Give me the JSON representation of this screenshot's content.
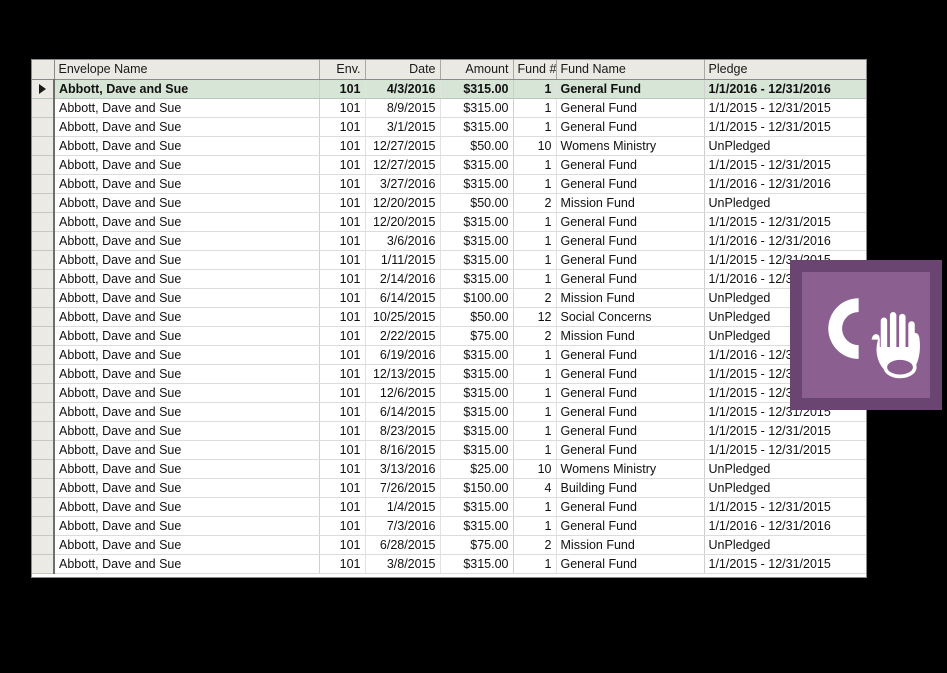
{
  "grid": {
    "columns": [
      {
        "key": "selector",
        "label": "",
        "align": "center"
      },
      {
        "key": "envelope_name",
        "label": "Envelope Name",
        "align": "left"
      },
      {
        "key": "env",
        "label": "Env.",
        "align": "right"
      },
      {
        "key": "date",
        "label": "Date",
        "align": "right"
      },
      {
        "key": "amount",
        "label": "Amount",
        "align": "right"
      },
      {
        "key": "fund_num",
        "label": "Fund #",
        "align": "right"
      },
      {
        "key": "fund_name",
        "label": "Fund Name",
        "align": "left"
      },
      {
        "key": "pledge",
        "label": "Pledge",
        "align": "left"
      }
    ],
    "selected_row_index": 0,
    "row_marker_glyph": "right-triangle",
    "rows": [
      {
        "envelope_name": "Abbott, Dave and Sue",
        "env": "101",
        "date": "4/3/2016",
        "amount": "$315.00",
        "fund_num": "1",
        "fund_name": "General Fund",
        "pledge": "1/1/2016 - 12/31/2016"
      },
      {
        "envelope_name": "Abbott, Dave and Sue",
        "env": "101",
        "date": "8/9/2015",
        "amount": "$315.00",
        "fund_num": "1",
        "fund_name": "General Fund",
        "pledge": "1/1/2015 - 12/31/2015"
      },
      {
        "envelope_name": "Abbott, Dave and Sue",
        "env": "101",
        "date": "3/1/2015",
        "amount": "$315.00",
        "fund_num": "1",
        "fund_name": "General Fund",
        "pledge": "1/1/2015 - 12/31/2015"
      },
      {
        "envelope_name": "Abbott, Dave and Sue",
        "env": "101",
        "date": "12/27/2015",
        "amount": "$50.00",
        "fund_num": "10",
        "fund_name": "Womens Ministry",
        "pledge": "UnPledged"
      },
      {
        "envelope_name": "Abbott, Dave and Sue",
        "env": "101",
        "date": "12/27/2015",
        "amount": "$315.00",
        "fund_num": "1",
        "fund_name": "General Fund",
        "pledge": "1/1/2015 - 12/31/2015"
      },
      {
        "envelope_name": "Abbott, Dave and Sue",
        "env": "101",
        "date": "3/27/2016",
        "amount": "$315.00",
        "fund_num": "1",
        "fund_name": "General Fund",
        "pledge": "1/1/2016 - 12/31/2016"
      },
      {
        "envelope_name": "Abbott, Dave and Sue",
        "env": "101",
        "date": "12/20/2015",
        "amount": "$50.00",
        "fund_num": "2",
        "fund_name": "Mission Fund",
        "pledge": "UnPledged"
      },
      {
        "envelope_name": "Abbott, Dave and Sue",
        "env": "101",
        "date": "12/20/2015",
        "amount": "$315.00",
        "fund_num": "1",
        "fund_name": "General Fund",
        "pledge": "1/1/2015 - 12/31/2015"
      },
      {
        "envelope_name": "Abbott, Dave and Sue",
        "env": "101",
        "date": "3/6/2016",
        "amount": "$315.00",
        "fund_num": "1",
        "fund_name": "General Fund",
        "pledge": "1/1/2016 - 12/31/2016"
      },
      {
        "envelope_name": "Abbott, Dave and Sue",
        "env": "101",
        "date": "1/11/2015",
        "amount": "$315.00",
        "fund_num": "1",
        "fund_name": "General Fund",
        "pledge": "1/1/2015 - 12/31/2015"
      },
      {
        "envelope_name": "Abbott, Dave and Sue",
        "env": "101",
        "date": "2/14/2016",
        "amount": "$315.00",
        "fund_num": "1",
        "fund_name": "General Fund",
        "pledge": "1/1/2016 - 12/31/2016"
      },
      {
        "envelope_name": "Abbott, Dave and Sue",
        "env": "101",
        "date": "6/14/2015",
        "amount": "$100.00",
        "fund_num": "2",
        "fund_name": "Mission Fund",
        "pledge": "UnPledged"
      },
      {
        "envelope_name": "Abbott, Dave and Sue",
        "env": "101",
        "date": "10/25/2015",
        "amount": "$50.00",
        "fund_num": "12",
        "fund_name": "Social Concerns",
        "pledge": "UnPledged"
      },
      {
        "envelope_name": "Abbott, Dave and Sue",
        "env": "101",
        "date": "2/22/2015",
        "amount": "$75.00",
        "fund_num": "2",
        "fund_name": "Mission Fund",
        "pledge": "UnPledged"
      },
      {
        "envelope_name": "Abbott, Dave and Sue",
        "env": "101",
        "date": "6/19/2016",
        "amount": "$315.00",
        "fund_num": "1",
        "fund_name": "General Fund",
        "pledge": "1/1/2016 - 12/31/2016"
      },
      {
        "envelope_name": "Abbott, Dave and Sue",
        "env": "101",
        "date": "12/13/2015",
        "amount": "$315.00",
        "fund_num": "1",
        "fund_name": "General Fund",
        "pledge": "1/1/2015 - 12/31/2015"
      },
      {
        "envelope_name": "Abbott, Dave and Sue",
        "env": "101",
        "date": "12/6/2015",
        "amount": "$315.00",
        "fund_num": "1",
        "fund_name": "General Fund",
        "pledge": "1/1/2015 - 12/31/2015"
      },
      {
        "envelope_name": "Abbott, Dave and Sue",
        "env": "101",
        "date": "6/14/2015",
        "amount": "$315.00",
        "fund_num": "1",
        "fund_name": "General Fund",
        "pledge": "1/1/2015 - 12/31/2015"
      },
      {
        "envelope_name": "Abbott, Dave and Sue",
        "env": "101",
        "date": "8/23/2015",
        "amount": "$315.00",
        "fund_num": "1",
        "fund_name": "General Fund",
        "pledge": "1/1/2015 - 12/31/2015"
      },
      {
        "envelope_name": "Abbott, Dave and Sue",
        "env": "101",
        "date": "8/16/2015",
        "amount": "$315.00",
        "fund_num": "1",
        "fund_name": "General Fund",
        "pledge": "1/1/2015 - 12/31/2015"
      },
      {
        "envelope_name": "Abbott, Dave and Sue",
        "env": "101",
        "date": "3/13/2016",
        "amount": "$25.00",
        "fund_num": "10",
        "fund_name": "Womens Ministry",
        "pledge": "UnPledged"
      },
      {
        "envelope_name": "Abbott, Dave and Sue",
        "env": "101",
        "date": "7/26/2015",
        "amount": "$150.00",
        "fund_num": "4",
        "fund_name": "Building Fund",
        "pledge": "UnPledged"
      },
      {
        "envelope_name": "Abbott, Dave and Sue",
        "env": "101",
        "date": "1/4/2015",
        "amount": "$315.00",
        "fund_num": "1",
        "fund_name": "General Fund",
        "pledge": "1/1/2015 - 12/31/2015"
      },
      {
        "envelope_name": "Abbott, Dave and Sue",
        "env": "101",
        "date": "7/3/2016",
        "amount": "$315.00",
        "fund_num": "1",
        "fund_name": "General Fund",
        "pledge": "1/1/2016 - 12/31/2016"
      },
      {
        "envelope_name": "Abbott, Dave and Sue",
        "env": "101",
        "date": "6/28/2015",
        "amount": "$75.00",
        "fund_num": "2",
        "fund_name": "Mission Fund",
        "pledge": "UnPledged"
      },
      {
        "envelope_name": "Abbott, Dave and Sue",
        "env": "101",
        "date": "3/8/2015",
        "amount": "$315.00",
        "fund_num": "1",
        "fund_name": "General Fund",
        "pledge": "1/1/2015 - 12/31/2015"
      }
    ]
  },
  "logo": {
    "name": "church-app-logo",
    "letter": "C",
    "symbol": "hand-with-offering-plate",
    "fill_color": "#8b6091",
    "border_color": "#6b4572",
    "mark_color": "#ffffff"
  },
  "colors": {
    "background": "#000000",
    "header_background": "#ebe9e4",
    "selected_row_background": "#d7e5d7",
    "row_background": "#ffffff",
    "grid_line": "#dcdcdc",
    "text": "#111111"
  }
}
